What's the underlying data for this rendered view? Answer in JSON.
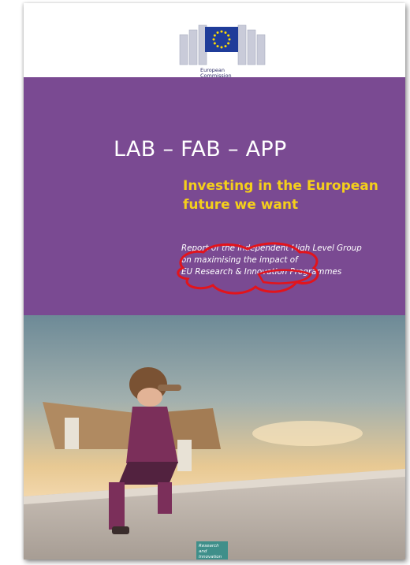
{
  "cover": {
    "logo_text": "European\nCommission",
    "title": "LAB – FAB – APP",
    "subtitle": "Investing in the European future we want",
    "report_line": "Report of the independent High Level Group\non maximising the impact of\nEU Research & Innovation Programmes",
    "badge": "Research and\nInnovation"
  },
  "colors": {
    "purple_band": "#7a4a92",
    "subtitle_yellow": "#f4cf1b",
    "scribble_red": "#e2141c",
    "eu_flag_blue": "#1f3c99",
    "eu_stars": "#ffdd00"
  }
}
